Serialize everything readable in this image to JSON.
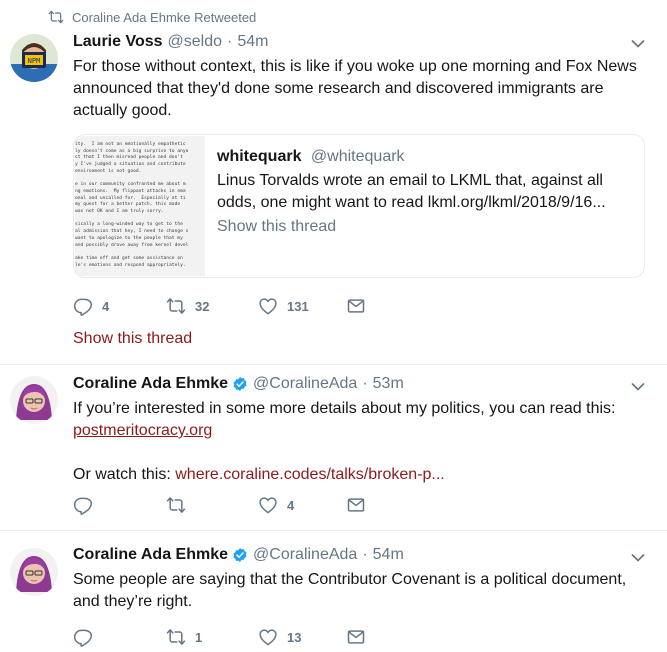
{
  "tweets": [
    {
      "retweet_label": "Coraline Ada Ehmke Retweeted",
      "name": "Laurie Voss",
      "handle": "@seldo",
      "time": "54m",
      "text": "For those without context, this is like if you woke up one morning and Fox News announced that they'd done some research and discovered immigrants are actually good.",
      "quote": {
        "name": "whitequark",
        "handle": "@whitequark",
        "text": "Linus Torvalds wrote an email to LKML that, against all odds, one might want to read lkml.org/lkml/2018/9/16...",
        "show_thread": "Show this thread",
        "image_text": "ity.  I am not an emotionally empathetic\nly doesn't come as a big surprise to anyo\nct that I then misread people and don't\ny I've judged a situation and contribute\nenvironment is not good.\n\ne in our community confronted me about m\nng emotions.  My flippant attacks in ema\nonal and uncalled for.  Especially at ti\nmy quest for a better patch, this made\nwas not OK and I am truly sorry.\n\nsically a long-winded way to get to the\nal admission that hey, I need to change s\nwant to apologize to the people that my\nand possibly drove away from kernel devel\n\nake time off and get some assistance on\nle's emotions and respond appropriately."
      },
      "replies": "4",
      "retweets": "32",
      "likes": "131",
      "show_thread": "Show this thread"
    },
    {
      "name": "Coraline Ada Ehmke",
      "handle": "@CoralineAda",
      "time": "53m",
      "text_line1": "If you’re interested in some more details about my politics, you can read this:",
      "link1": "postmeritocracy.org",
      "text_line2_prefix": "Or watch this: ",
      "link2": "where.coraline.codes/talks/broken-p...",
      "replies": "",
      "retweets": "",
      "likes": "4"
    },
    {
      "name": "Coraline Ada Ehmke",
      "handle": "@CoralineAda",
      "time": "54m",
      "text": "Some people are saying that the Contributor Covenant is a political document, and they’re right.",
      "replies": "",
      "retweets": "1",
      "likes": "13"
    }
  ],
  "colors": {
    "link": "#8b1a1a",
    "secondary_text": "#657786",
    "verified_badge": "#1da1f2",
    "divider": "#e6ecf0"
  },
  "icons": [
    "retweet-icon",
    "reply-icon",
    "like-icon",
    "message-icon",
    "chevron-down-icon",
    "verified-badge-icon"
  ]
}
